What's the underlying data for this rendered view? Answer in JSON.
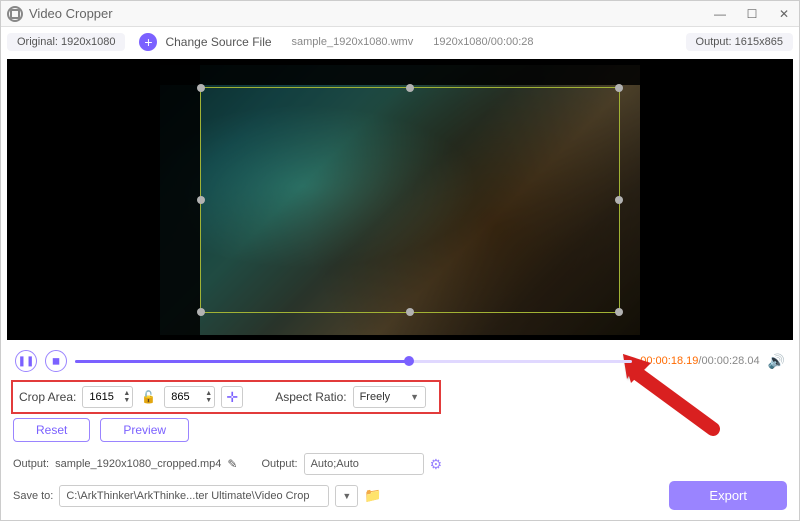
{
  "window": {
    "title": "Video Cropper"
  },
  "toprow": {
    "original": "Original: 1920x1080",
    "change_source": "Change Source File",
    "filename": "sample_1920x1080.wmv",
    "dimensions_time": "1920x1080/00:00:28",
    "output": "Output: 1615x865"
  },
  "playback": {
    "current_time": "00:00:18.19",
    "total_time": "/00:00:28.04"
  },
  "crop": {
    "label": "Crop Area:",
    "width": "1615",
    "height": "865",
    "aspect_label": "Aspect Ratio:",
    "aspect_value": "Freely"
  },
  "buttons": {
    "reset": "Reset",
    "preview": "Preview",
    "export": "Export"
  },
  "output_row": {
    "label": "Output:",
    "filename": "sample_1920x1080_cropped.mp4",
    "settings_label": "Output:",
    "settings_value": "Auto;Auto"
  },
  "save_row": {
    "label": "Save to:",
    "path": "C:\\ArkThinker\\ArkThinke...ter Ultimate\\Video Crop"
  },
  "colors": {
    "accent": "#7b61ff",
    "highlight": "#e23b3b",
    "orange": "#ff6a00"
  }
}
